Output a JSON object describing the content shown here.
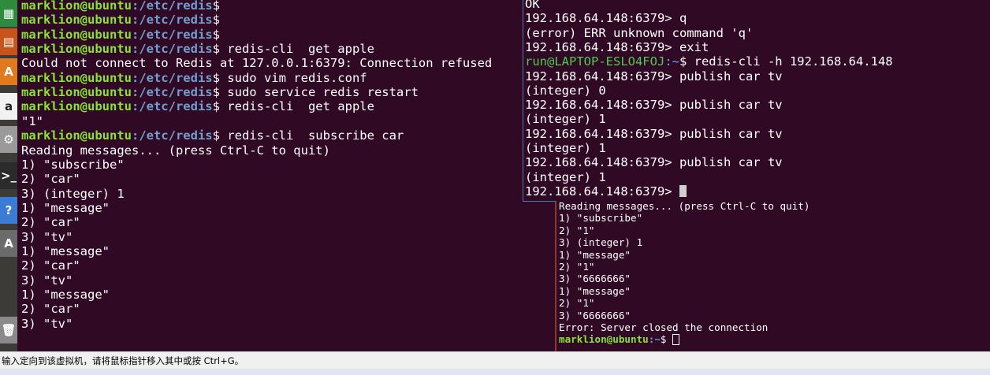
{
  "launcher": {
    "icons": [
      {
        "name": "calc-icon",
        "glyph": "▦",
        "bg": "#2e8b3e"
      },
      {
        "name": "impress-icon",
        "glyph": "▤",
        "bg": "#c8541c"
      },
      {
        "name": "software-center-icon",
        "glyph": "A",
        "bg": "#e07a1f"
      },
      {
        "name": "amazon-icon",
        "glyph": "a",
        "bg": "#f2f2f2"
      },
      {
        "name": "settings-icon",
        "glyph": "⚙",
        "bg": "#9a9a9a"
      },
      {
        "name": "terminal-icon",
        "glyph": ">_",
        "bg": "#2b2b2b"
      },
      {
        "name": "help-icon",
        "glyph": "?",
        "bg": "#3a7bd5"
      },
      {
        "name": "update-icon",
        "glyph": "A",
        "bg": "#6b6b6b"
      },
      {
        "name": "trash-icon",
        "glyph": "🗑",
        "bg": "#8a8a8a"
      }
    ]
  },
  "term_left": {
    "lines": [
      {
        "user": "marklion@ubuntu",
        "path": ":/etc/redis",
        "text": "$"
      },
      {
        "user": "marklion@ubuntu",
        "path": ":/etc/redis",
        "text": "$"
      },
      {
        "user": "marklion@ubuntu",
        "path": ":/etc/redis",
        "text": "$"
      },
      {
        "user": "marklion@ubuntu",
        "path": ":/etc/redis",
        "text": "$ redis-cli  get apple"
      },
      {
        "text": "Could not connect to Redis at 127.0.0.1:6379: Connection refused"
      },
      {
        "user": "marklion@ubuntu",
        "path": ":/etc/redis",
        "text": "$ sudo vim redis.conf"
      },
      {
        "user": "marklion@ubuntu",
        "path": ":/etc/redis",
        "text": "$ sudo service redis restart"
      },
      {
        "user": "marklion@ubuntu",
        "path": ":/etc/redis",
        "text": "$ redis-cli  get apple"
      },
      {
        "text": "\"1\""
      },
      {
        "user": "marklion@ubuntu",
        "path": ":/etc/redis",
        "text": "$ redis-cli  subscribe car"
      },
      {
        "text": "Reading messages... (press Ctrl-C to quit)"
      },
      {
        "text": "1) \"subscribe\""
      },
      {
        "text": "2) \"car\""
      },
      {
        "text": "3) (integer) 1"
      },
      {
        "text": "1) \"message\""
      },
      {
        "text": "2) \"car\""
      },
      {
        "text": "3) \"tv\""
      },
      {
        "text": "1) \"message\""
      },
      {
        "text": "2) \"car\""
      },
      {
        "text": "3) \"tv\""
      },
      {
        "text": "1) \"message\""
      },
      {
        "text": "2) \"car\""
      },
      {
        "text": "3) \"tv\""
      }
    ]
  },
  "term_right_top": {
    "lines": [
      {
        "text": "OK"
      },
      {
        "text": "192.168.64.148:6379> q"
      },
      {
        "text": "(error) ERR unknown command 'q'"
      },
      {
        "text": "192.168.64.148:6379> exit"
      },
      {
        "user": "run@LAPTOP-ESLO4FOJ",
        "path": ":~",
        "text": "$ redis-cli -h 192.168.64.148"
      },
      {
        "text": "192.168.64.148:6379> publish car tv"
      },
      {
        "text": "(integer) 0"
      },
      {
        "text": "192.168.64.148:6379> publish car tv"
      },
      {
        "text": "(integer) 1"
      },
      {
        "text": "192.168.64.148:6379> publish car tv"
      },
      {
        "text": "(integer) 1"
      },
      {
        "text": "192.168.64.148:6379> publish car tv"
      },
      {
        "text": "(integer) 1"
      },
      {
        "text": "192.168.64.148:6379> ",
        "cursor": true
      }
    ]
  },
  "term_right_bottom": {
    "lines": [
      {
        "text": "Reading messages... (press Ctrl-C to quit)"
      },
      {
        "text": "1) \"subscribe\""
      },
      {
        "text": "2) \"1\""
      },
      {
        "text": "3) (integer) 1"
      },
      {
        "text": "1) \"message\""
      },
      {
        "text": "2) \"1\""
      },
      {
        "text": "3) \"6666666\""
      },
      {
        "text": "1) \"message\""
      },
      {
        "text": "2) \"1\""
      },
      {
        "text": "3) \"6666666\""
      },
      {
        "text": "Error: Server closed the connection"
      },
      {
        "user": "marklion@ubuntu",
        "path": ":~",
        "text": "$ ",
        "cursor": true
      }
    ]
  },
  "hint_bar": {
    "text": "输入定向到该虚拟机，请将鼠标指针移入其中或按 Ctrl+G。"
  },
  "colors": {
    "background": "#300a24",
    "user": "#8ae234",
    "path": "#729fcf"
  }
}
